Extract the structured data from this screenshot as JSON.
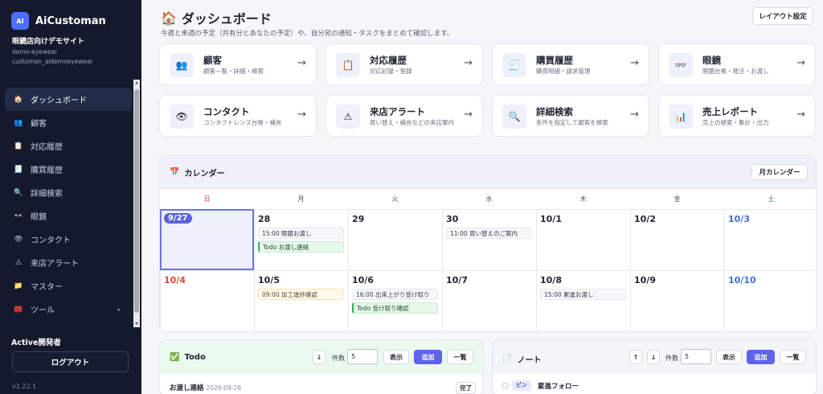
{
  "brand": {
    "logo": "AI",
    "name": "AiCustoman"
  },
  "site": {
    "name": "眼鏡店向けデモサイト",
    "tenant": "demo-eyewear",
    "user": "customan_aidemoeyewear"
  },
  "nav": [
    {
      "label": "ダッシュボード",
      "icon": "🏠",
      "icon_name": "home-icon",
      "active": true
    },
    {
      "label": "顧客",
      "icon": "👥",
      "icon_name": "users-icon"
    },
    {
      "label": "対応履歴",
      "icon": "📋",
      "icon_name": "clipboard-icon"
    },
    {
      "label": "購買履歴",
      "icon": "🧾",
      "icon_name": "receipt-icon"
    },
    {
      "label": "詳細検索",
      "icon": "🔍",
      "icon_name": "search-icon"
    },
    {
      "label": "眼鏡",
      "icon": "👓",
      "icon_name": "glasses-icon"
    },
    {
      "label": "コンタクト",
      "icon": "👁",
      "icon_name": "eye-icon"
    },
    {
      "label": "来店アラート",
      "icon": "⚠",
      "icon_name": "warning-icon"
    },
    {
      "label": "マスター",
      "icon": "📁",
      "icon_name": "folder-icon"
    },
    {
      "label": "ツール",
      "icon": "🧰",
      "icon_name": "toolbox-icon",
      "caret": "▸"
    }
  ],
  "footer": {
    "dev_label": "Active開発者",
    "logout": "ログアウト",
    "version": "v1.22.1"
  },
  "header": {
    "icon": "🏠",
    "title": "ダッシュボード",
    "description": "今週と来週の予定（共有分とあなたの予定）や、自分宛の通知・タスクをまとめて確認します。",
    "layout_button": "レイアウト設定"
  },
  "cards": [
    {
      "title": "顧客",
      "sub": "顧客一覧・詳細・検索",
      "icon": "👥",
      "icon_name": "users-icon"
    },
    {
      "title": "対応履歴",
      "sub": "対応記録・登録",
      "icon": "📋",
      "icon_name": "clipboard-icon"
    },
    {
      "title": "購買履歴",
      "sub": "購買明細・請求管理",
      "icon": "🧾",
      "icon_name": "receipt-icon"
    },
    {
      "title": "眼鏡",
      "sub": "眼鏡台帳・発注・お渡し",
      "icon": "👓",
      "icon_name": "glasses-icon"
    },
    {
      "title": "コンタクト",
      "sub": "コンタクトレンズ台帳・補充",
      "icon": "👁",
      "icon_name": "eye-icon"
    },
    {
      "title": "来店アラート",
      "sub": "買い替え・補充などの来店案内",
      "icon": "⚠",
      "icon_name": "warning-icon"
    },
    {
      "title": "詳細検索",
      "sub": "条件を指定して顧客を検索",
      "icon": "🔍",
      "icon_name": "search-icon"
    },
    {
      "title": "売上レポート",
      "sub": "売上の検索・集計・出力",
      "icon": "📊",
      "icon_name": "chart-icon"
    }
  ],
  "card_arrow": "→",
  "calendar": {
    "icon": "📅",
    "title": "カレンダー",
    "month_button": "月カレンダー",
    "weekdays": [
      "日",
      "月",
      "火",
      "水",
      "木",
      "金",
      "土"
    ],
    "colors": {
      "sunday": "#d9463b",
      "saturday": "#3e6fd1",
      "normal": "#1f2430"
    },
    "weeks": [
      [
        {
          "label": "9/27",
          "today": true,
          "events": []
        },
        {
          "label": "28",
          "events": [
            {
              "text": "15:00 眼鏡お渡し",
              "kind": "plain"
            },
            {
              "text": "Todo お渡し連絡",
              "kind": "todo"
            }
          ]
        },
        {
          "label": "29",
          "events": []
        },
        {
          "label": "30",
          "events": [
            {
              "text": "11:00 買い替えのご案内",
              "kind": "plain"
            }
          ]
        },
        {
          "label": "10/1",
          "events": []
        },
        {
          "label": "10/2",
          "events": []
        },
        {
          "label": "10/3",
          "events": []
        }
      ],
      [
        {
          "label": "10/4",
          "events": []
        },
        {
          "label": "10/5",
          "events": [
            {
              "text": "09:00 加工進捗確認",
              "kind": "yellow"
            }
          ]
        },
        {
          "label": "10/6",
          "events": [
            {
              "text": "16:00 出来上がり受け取り",
              "kind": "plain"
            },
            {
              "text": "Todo 受け取り確認",
              "kind": "todo"
            }
          ]
        },
        {
          "label": "10/7",
          "events": []
        },
        {
          "label": "10/8",
          "events": [
            {
              "text": "15:00 累進お渡し",
              "kind": "plain"
            }
          ]
        },
        {
          "label": "10/9",
          "events": []
        },
        {
          "label": "10/10",
          "events": []
        }
      ]
    ]
  },
  "todo": {
    "icon": "✅",
    "title": "Todo",
    "sort_icon": "↓",
    "count_label": "件数",
    "count_value": "5",
    "show": "表示",
    "add": "追加",
    "list": "一覧",
    "items": [
      {
        "text": "お渡し連絡",
        "date": "2026-09-28",
        "action": "完了"
      }
    ]
  },
  "notes": {
    "icon": "📄",
    "title": "ノート",
    "up_icon": "↑",
    "down_icon": "↓",
    "count_label": "件数",
    "count_value": "5",
    "show": "表示",
    "add": "追加",
    "list": "一覧",
    "items": [
      {
        "pin": "ピン",
        "text": "累進フォロー"
      }
    ]
  }
}
